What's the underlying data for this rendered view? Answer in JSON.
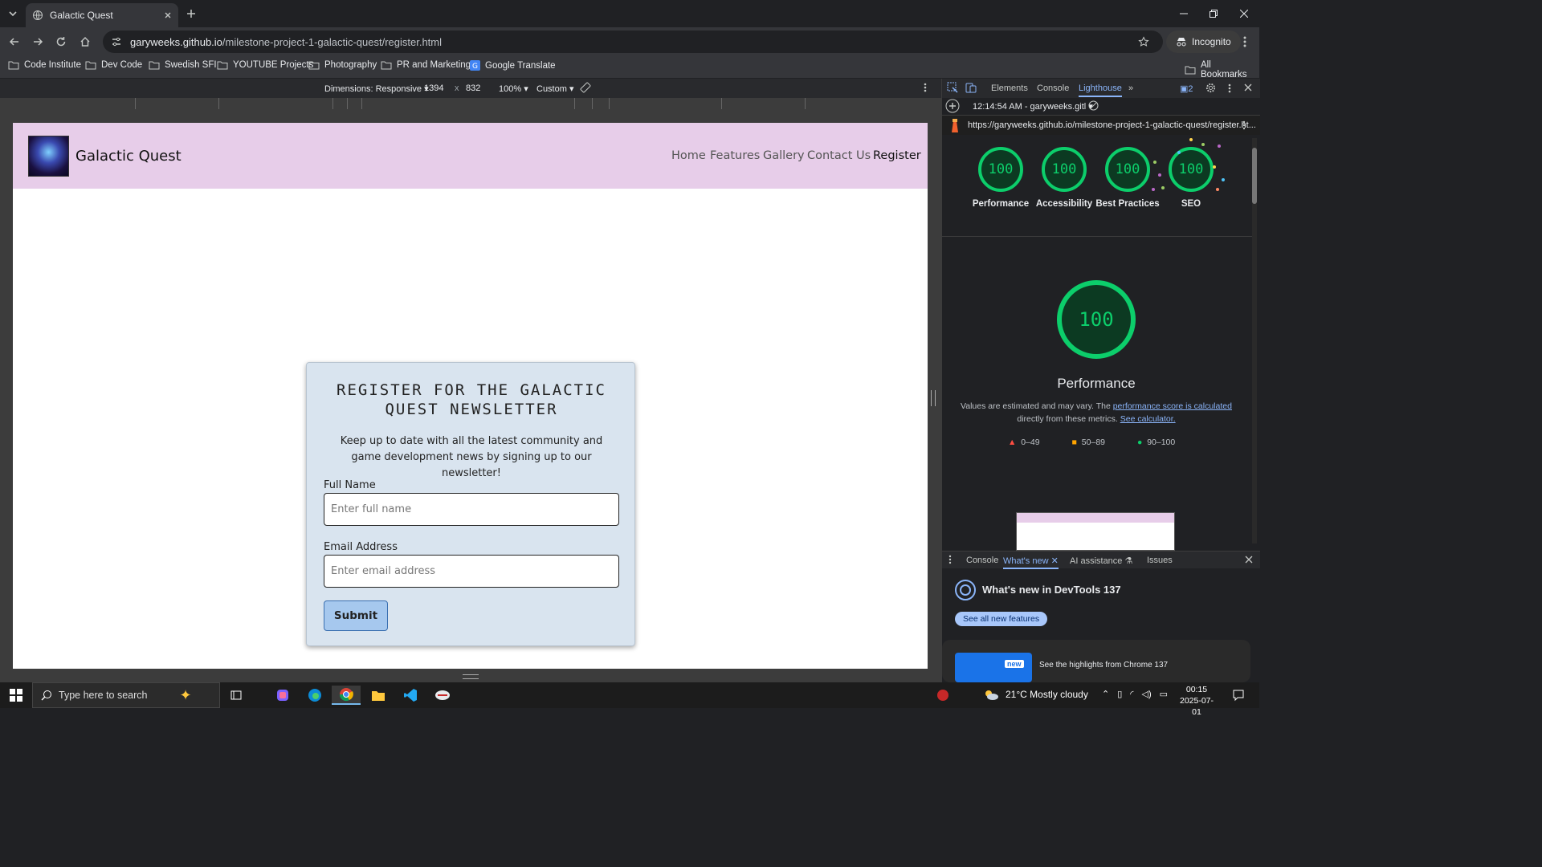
{
  "browser": {
    "tab_title": "Galactic Quest",
    "url_host": "garyweeks.github.io",
    "url_path": "/milestone-project-1-galactic-quest/register.html",
    "profile_label": "Incognito",
    "bookmarks": [
      "Code Institute",
      "Dev Code",
      "Swedish SFI",
      "YOUTUBE Projects",
      "Photography",
      "PR and Marketing",
      "Google Translate"
    ],
    "all_bookmarks_label": "All Bookmarks"
  },
  "device_toolbar": {
    "dimensions_label": "Dimensions: Responsive",
    "width": "1394",
    "times": "x",
    "height": "832",
    "zoom": "100%",
    "throttle": "Custom"
  },
  "site": {
    "brand": "Galactic Quest",
    "nav": [
      "Home",
      "Features",
      "Gallery",
      "Contact Us",
      "Register"
    ],
    "form": {
      "heading": "REGISTER FOR THE GALACTIC QUEST NEWSLETTER",
      "intro": "Keep up to date with all the latest community and game development news by signing up to our newsletter!",
      "name_label": "Full Name",
      "name_placeholder": "Enter full name",
      "email_label": "Email Address",
      "email_placeholder": "Enter email address",
      "submit_label": "Submit"
    }
  },
  "devtools": {
    "tabs": [
      "Elements",
      "Console",
      "Lighthouse"
    ],
    "issues_count": "2",
    "report_time": "12:14:54 AM - garyweeks.gitl",
    "report_url": "https://garyweeks.github.io/milestone-project-1-galactic-quest/register.ht...",
    "scores": [
      {
        "label": "Performance",
        "value": "100"
      },
      {
        "label": "Accessibility",
        "value": "100"
      },
      {
        "label": "Best Practices",
        "value": "100"
      },
      {
        "label": "SEO",
        "value": "100"
      }
    ],
    "main_score": "100",
    "main_label": "Performance",
    "note_prefix": "Values are estimated and may vary. The ",
    "note_link1": "performance score is calculated",
    "note_mid": "directly from these metrics. ",
    "note_link2": "See calculator.",
    "legend": [
      "0–49",
      "50–89",
      "90–100"
    ],
    "drawer_tabs": [
      "Console",
      "What's new",
      "AI assistance",
      "Issues"
    ],
    "whats_new_title": "What's new in DevTools 137",
    "see_features": "See all new features",
    "new_badge": "new",
    "highlights": "See the highlights from Chrome 137",
    "colors": {
      "pass": "#0cce6b",
      "average": "#ffa400",
      "fail": "#ff4e42"
    }
  },
  "taskbar": {
    "search_placeholder": "Type here to search",
    "weather": "21°C  Mostly cloudy",
    "time": "00:15",
    "date": "2025-07-01"
  }
}
